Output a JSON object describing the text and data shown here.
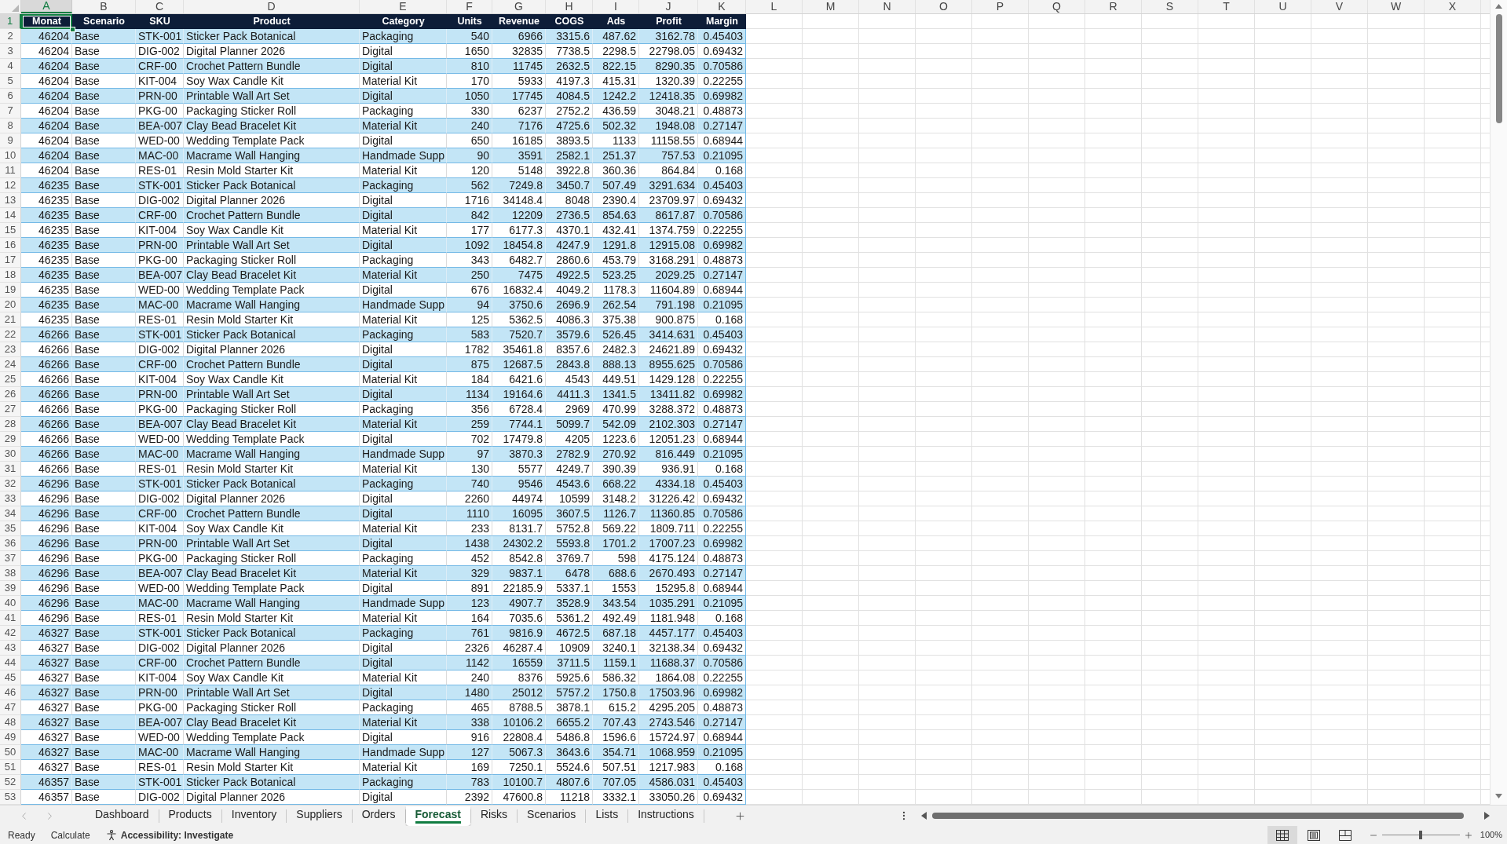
{
  "columns": [
    {
      "letter": "A",
      "selected": true
    },
    {
      "letter": "B",
      "selected": false
    },
    {
      "letter": "C",
      "selected": false
    },
    {
      "letter": "D",
      "selected": false
    },
    {
      "letter": "E",
      "selected": false
    },
    {
      "letter": "F",
      "selected": false
    },
    {
      "letter": "G",
      "selected": false
    },
    {
      "letter": "H",
      "selected": false
    },
    {
      "letter": "I",
      "selected": false
    },
    {
      "letter": "J",
      "selected": false
    },
    {
      "letter": "K",
      "selected": false
    },
    {
      "letter": "L",
      "selected": false
    },
    {
      "letter": "M",
      "selected": false
    },
    {
      "letter": "N",
      "selected": false
    },
    {
      "letter": "O",
      "selected": false
    },
    {
      "letter": "P",
      "selected": false
    },
    {
      "letter": "Q",
      "selected": false
    },
    {
      "letter": "R",
      "selected": false
    },
    {
      "letter": "S",
      "selected": false
    },
    {
      "letter": "T",
      "selected": false
    },
    {
      "letter": "U",
      "selected": false
    },
    {
      "letter": "V",
      "selected": false
    },
    {
      "letter": "W",
      "selected": false
    },
    {
      "letter": "X",
      "selected": false
    }
  ],
  "header_row": {
    "number": "1",
    "selected": true,
    "cells": [
      {
        "label": "Monat",
        "kind": "number"
      },
      {
        "label": "Scenario",
        "kind": "text"
      },
      {
        "label": "SKU",
        "kind": "text"
      },
      {
        "label": "Product",
        "kind": "text"
      },
      {
        "label": "Category",
        "kind": "text"
      },
      {
        "label": "Units",
        "kind": "number"
      },
      {
        "label": "Revenue",
        "kind": "number"
      },
      {
        "label": "COGS",
        "kind": "number"
      },
      {
        "label": "Ads",
        "kind": "number"
      },
      {
        "label": "Profit",
        "kind": "number"
      },
      {
        "label": "Margin",
        "kind": "number"
      }
    ]
  },
  "rows": [
    {
      "number": "2",
      "selected": false,
      "cells": [
        "46204",
        "Base",
        "STK-001",
        "Sticker Pack Botanical",
        "Packaging",
        "540",
        "6966",
        "3315.6",
        "487.62",
        "3162.78",
        "0.45403"
      ]
    },
    {
      "number": "3",
      "selected": false,
      "cells": [
        "46204",
        "Base",
        "DIG-002",
        "Digital Planner 2026",
        "Digital",
        "1650",
        "32835",
        "7738.5",
        "2298.5",
        "22798.05",
        "0.69432"
      ]
    },
    {
      "number": "4",
      "selected": false,
      "cells": [
        "46204",
        "Base",
        "CRF-00",
        "Crochet Pattern Bundle",
        "Digital",
        "810",
        "11745",
        "2632.5",
        "822.15",
        "8290.35",
        "0.70586"
      ]
    },
    {
      "number": "5",
      "selected": false,
      "cells": [
        "46204",
        "Base",
        "KIT-004",
        "Soy Wax Candle Kit",
        "Material Kit",
        "170",
        "5933",
        "4197.3",
        "415.31",
        "1320.39",
        "0.22255"
      ]
    },
    {
      "number": "6",
      "selected": false,
      "cells": [
        "46204",
        "Base",
        "PRN-00",
        "Printable Wall Art Set",
        "Digital",
        "1050",
        "17745",
        "4084.5",
        "1242.2",
        "12418.35",
        "0.69982"
      ]
    },
    {
      "number": "7",
      "selected": false,
      "cells": [
        "46204",
        "Base",
        "PKG-00",
        "Packaging Sticker Roll",
        "Packaging",
        "330",
        "6237",
        "2752.2",
        "436.59",
        "3048.21",
        "0.48873"
      ]
    },
    {
      "number": "8",
      "selected": false,
      "cells": [
        "46204",
        "Base",
        "BEA-007",
        "Clay Bead Bracelet Kit",
        "Material Kit",
        "240",
        "7176",
        "4725.6",
        "502.32",
        "1948.08",
        "0.27147"
      ]
    },
    {
      "number": "9",
      "selected": false,
      "cells": [
        "46204",
        "Base",
        "WED-00",
        "Wedding Template Pack",
        "Digital",
        "650",
        "16185",
        "3893.5",
        "1133",
        "11158.55",
        "0.68944"
      ]
    },
    {
      "number": "10",
      "selected": false,
      "cells": [
        "46204",
        "Base",
        "MAC-00",
        "Macrame Wall Hanging",
        "Handmade Supp",
        "90",
        "3591",
        "2582.1",
        "251.37",
        "757.53",
        "0.21095"
      ]
    },
    {
      "number": "11",
      "selected": false,
      "cells": [
        "46204",
        "Base",
        "RES-01",
        "Resin Mold Starter Kit",
        "Material Kit",
        "120",
        "5148",
        "3922.8",
        "360.36",
        "864.84",
        "0.168"
      ]
    },
    {
      "number": "12",
      "selected": false,
      "cells": [
        "46235",
        "Base",
        "STK-001",
        "Sticker Pack Botanical",
        "Packaging",
        "562",
        "7249.8",
        "3450.7",
        "507.49",
        "3291.634",
        "0.45403"
      ]
    },
    {
      "number": "13",
      "selected": false,
      "cells": [
        "46235",
        "Base",
        "DIG-002",
        "Digital Planner 2026",
        "Digital",
        "1716",
        "34148.4",
        "8048",
        "2390.4",
        "23709.97",
        "0.69432"
      ]
    },
    {
      "number": "14",
      "selected": false,
      "cells": [
        "46235",
        "Base",
        "CRF-00",
        "Crochet Pattern Bundle",
        "Digital",
        "842",
        "12209",
        "2736.5",
        "854.63",
        "8617.87",
        "0.70586"
      ]
    },
    {
      "number": "15",
      "selected": false,
      "cells": [
        "46235",
        "Base",
        "KIT-004",
        "Soy Wax Candle Kit",
        "Material Kit",
        "177",
        "6177.3",
        "4370.1",
        "432.41",
        "1374.759",
        "0.22255"
      ]
    },
    {
      "number": "16",
      "selected": false,
      "cells": [
        "46235",
        "Base",
        "PRN-00",
        "Printable Wall Art Set",
        "Digital",
        "1092",
        "18454.8",
        "4247.9",
        "1291.8",
        "12915.08",
        "0.69982"
      ]
    },
    {
      "number": "17",
      "selected": false,
      "cells": [
        "46235",
        "Base",
        "PKG-00",
        "Packaging Sticker Roll",
        "Packaging",
        "343",
        "6482.7",
        "2860.6",
        "453.79",
        "3168.291",
        "0.48873"
      ]
    },
    {
      "number": "18",
      "selected": false,
      "cells": [
        "46235",
        "Base",
        "BEA-007",
        "Clay Bead Bracelet Kit",
        "Material Kit",
        "250",
        "7475",
        "4922.5",
        "523.25",
        "2029.25",
        "0.27147"
      ]
    },
    {
      "number": "19",
      "selected": false,
      "cells": [
        "46235",
        "Base",
        "WED-00",
        "Wedding Template Pack",
        "Digital",
        "676",
        "16832.4",
        "4049.2",
        "1178.3",
        "11604.89",
        "0.68944"
      ]
    },
    {
      "number": "20",
      "selected": false,
      "cells": [
        "46235",
        "Base",
        "MAC-00",
        "Macrame Wall Hanging",
        "Handmade Supp",
        "94",
        "3750.6",
        "2696.9",
        "262.54",
        "791.198",
        "0.21095"
      ]
    },
    {
      "number": "21",
      "selected": false,
      "cells": [
        "46235",
        "Base",
        "RES-01",
        "Resin Mold Starter Kit",
        "Material Kit",
        "125",
        "5362.5",
        "4086.3",
        "375.38",
        "900.875",
        "0.168"
      ]
    },
    {
      "number": "22",
      "selected": false,
      "cells": [
        "46266",
        "Base",
        "STK-001",
        "Sticker Pack Botanical",
        "Packaging",
        "583",
        "7520.7",
        "3579.6",
        "526.45",
        "3414.631",
        "0.45403"
      ]
    },
    {
      "number": "23",
      "selected": false,
      "cells": [
        "46266",
        "Base",
        "DIG-002",
        "Digital Planner 2026",
        "Digital",
        "1782",
        "35461.8",
        "8357.6",
        "2482.3",
        "24621.89",
        "0.69432"
      ]
    },
    {
      "number": "24",
      "selected": false,
      "cells": [
        "46266",
        "Base",
        "CRF-00",
        "Crochet Pattern Bundle",
        "Digital",
        "875",
        "12687.5",
        "2843.8",
        "888.13",
        "8955.625",
        "0.70586"
      ]
    },
    {
      "number": "25",
      "selected": false,
      "cells": [
        "46266",
        "Base",
        "KIT-004",
        "Soy Wax Candle Kit",
        "Material Kit",
        "184",
        "6421.6",
        "4543",
        "449.51",
        "1429.128",
        "0.22255"
      ]
    },
    {
      "number": "26",
      "selected": false,
      "cells": [
        "46266",
        "Base",
        "PRN-00",
        "Printable Wall Art Set",
        "Digital",
        "1134",
        "19164.6",
        "4411.3",
        "1341.5",
        "13411.82",
        "0.69982"
      ]
    },
    {
      "number": "27",
      "selected": false,
      "cells": [
        "46266",
        "Base",
        "PKG-00",
        "Packaging Sticker Roll",
        "Packaging",
        "356",
        "6728.4",
        "2969",
        "470.99",
        "3288.372",
        "0.48873"
      ]
    },
    {
      "number": "28",
      "selected": false,
      "cells": [
        "46266",
        "Base",
        "BEA-007",
        "Clay Bead Bracelet Kit",
        "Material Kit",
        "259",
        "7744.1",
        "5099.7",
        "542.09",
        "2102.303",
        "0.27147"
      ]
    },
    {
      "number": "29",
      "selected": false,
      "cells": [
        "46266",
        "Base",
        "WED-00",
        "Wedding Template Pack",
        "Digital",
        "702",
        "17479.8",
        "4205",
        "1223.6",
        "12051.23",
        "0.68944"
      ]
    },
    {
      "number": "30",
      "selected": false,
      "cells": [
        "46266",
        "Base",
        "MAC-00",
        "Macrame Wall Hanging",
        "Handmade Supp",
        "97",
        "3870.3",
        "2782.9",
        "270.92",
        "816.449",
        "0.21095"
      ]
    },
    {
      "number": "31",
      "selected": false,
      "cells": [
        "46266",
        "Base",
        "RES-01",
        "Resin Mold Starter Kit",
        "Material Kit",
        "130",
        "5577",
        "4249.7",
        "390.39",
        "936.91",
        "0.168"
      ]
    },
    {
      "number": "32",
      "selected": false,
      "cells": [
        "46296",
        "Base",
        "STK-001",
        "Sticker Pack Botanical",
        "Packaging",
        "740",
        "9546",
        "4543.6",
        "668.22",
        "4334.18",
        "0.45403"
      ]
    },
    {
      "number": "33",
      "selected": false,
      "cells": [
        "46296",
        "Base",
        "DIG-002",
        "Digital Planner 2026",
        "Digital",
        "2260",
        "44974",
        "10599",
        "3148.2",
        "31226.42",
        "0.69432"
      ]
    },
    {
      "number": "34",
      "selected": false,
      "cells": [
        "46296",
        "Base",
        "CRF-00",
        "Crochet Pattern Bundle",
        "Digital",
        "1110",
        "16095",
        "3607.5",
        "1126.7",
        "11360.85",
        "0.70586"
      ]
    },
    {
      "number": "35",
      "selected": false,
      "cells": [
        "46296",
        "Base",
        "KIT-004",
        "Soy Wax Candle Kit",
        "Material Kit",
        "233",
        "8131.7",
        "5752.8",
        "569.22",
        "1809.711",
        "0.22255"
      ]
    },
    {
      "number": "36",
      "selected": false,
      "cells": [
        "46296",
        "Base",
        "PRN-00",
        "Printable Wall Art Set",
        "Digital",
        "1438",
        "24302.2",
        "5593.8",
        "1701.2",
        "17007.23",
        "0.69982"
      ]
    },
    {
      "number": "37",
      "selected": false,
      "cells": [
        "46296",
        "Base",
        "PKG-00",
        "Packaging Sticker Roll",
        "Packaging",
        "452",
        "8542.8",
        "3769.7",
        "598",
        "4175.124",
        "0.48873"
      ]
    },
    {
      "number": "38",
      "selected": false,
      "cells": [
        "46296",
        "Base",
        "BEA-007",
        "Clay Bead Bracelet Kit",
        "Material Kit",
        "329",
        "9837.1",
        "6478",
        "688.6",
        "2670.493",
        "0.27147"
      ]
    },
    {
      "number": "39",
      "selected": false,
      "cells": [
        "46296",
        "Base",
        "WED-00",
        "Wedding Template Pack",
        "Digital",
        "891",
        "22185.9",
        "5337.1",
        "1553",
        "15295.8",
        "0.68944"
      ]
    },
    {
      "number": "40",
      "selected": false,
      "cells": [
        "46296",
        "Base",
        "MAC-00",
        "Macrame Wall Hanging",
        "Handmade Supp",
        "123",
        "4907.7",
        "3528.9",
        "343.54",
        "1035.291",
        "0.21095"
      ]
    },
    {
      "number": "41",
      "selected": false,
      "cells": [
        "46296",
        "Base",
        "RES-01",
        "Resin Mold Starter Kit",
        "Material Kit",
        "164",
        "7035.6",
        "5361.2",
        "492.49",
        "1181.948",
        "0.168"
      ]
    },
    {
      "number": "42",
      "selected": false,
      "cells": [
        "46327",
        "Base",
        "STK-001",
        "Sticker Pack Botanical",
        "Packaging",
        "761",
        "9816.9",
        "4672.5",
        "687.18",
        "4457.177",
        "0.45403"
      ]
    },
    {
      "number": "43",
      "selected": false,
      "cells": [
        "46327",
        "Base",
        "DIG-002",
        "Digital Planner 2026",
        "Digital",
        "2326",
        "46287.4",
        "10909",
        "3240.1",
        "32138.34",
        "0.69432"
      ]
    },
    {
      "number": "44",
      "selected": false,
      "cells": [
        "46327",
        "Base",
        "CRF-00",
        "Crochet Pattern Bundle",
        "Digital",
        "1142",
        "16559",
        "3711.5",
        "1159.1",
        "11688.37",
        "0.70586"
      ]
    },
    {
      "number": "45",
      "selected": false,
      "cells": [
        "46327",
        "Base",
        "KIT-004",
        "Soy Wax Candle Kit",
        "Material Kit",
        "240",
        "8376",
        "5925.6",
        "586.32",
        "1864.08",
        "0.22255"
      ]
    },
    {
      "number": "46",
      "selected": false,
      "cells": [
        "46327",
        "Base",
        "PRN-00",
        "Printable Wall Art Set",
        "Digital",
        "1480",
        "25012",
        "5757.2",
        "1750.8",
        "17503.96",
        "0.69982"
      ]
    },
    {
      "number": "47",
      "selected": false,
      "cells": [
        "46327",
        "Base",
        "PKG-00",
        "Packaging Sticker Roll",
        "Packaging",
        "465",
        "8788.5",
        "3878.1",
        "615.2",
        "4295.205",
        "0.48873"
      ]
    },
    {
      "number": "48",
      "selected": false,
      "cells": [
        "46327",
        "Base",
        "BEA-007",
        "Clay Bead Bracelet Kit",
        "Material Kit",
        "338",
        "10106.2",
        "6655.2",
        "707.43",
        "2743.546",
        "0.27147"
      ]
    },
    {
      "number": "49",
      "selected": false,
      "cells": [
        "46327",
        "Base",
        "WED-00",
        "Wedding Template Pack",
        "Digital",
        "916",
        "22808.4",
        "5486.8",
        "1596.6",
        "15724.97",
        "0.68944"
      ]
    },
    {
      "number": "50",
      "selected": false,
      "cells": [
        "46327",
        "Base",
        "MAC-00",
        "Macrame Wall Hanging",
        "Handmade Supp",
        "127",
        "5067.3",
        "3643.6",
        "354.71",
        "1068.959",
        "0.21095"
      ]
    },
    {
      "number": "51",
      "selected": false,
      "cells": [
        "46327",
        "Base",
        "RES-01",
        "Resin Mold Starter Kit",
        "Material Kit",
        "169",
        "7250.1",
        "5524.6",
        "507.51",
        "1217.983",
        "0.168"
      ]
    },
    {
      "number": "52",
      "selected": false,
      "cells": [
        "46357",
        "Base",
        "STK-001",
        "Sticker Pack Botanical",
        "Packaging",
        "783",
        "10100.7",
        "4807.6",
        "707.05",
        "4586.031",
        "0.45403"
      ]
    },
    {
      "number": "53",
      "selected": false,
      "cells": [
        "46357",
        "Base",
        "DIG-002",
        "Digital Planner 2026",
        "Digital",
        "2392",
        "47600.8",
        "11218",
        "3332.1",
        "33050.26",
        "0.69432"
      ]
    }
  ],
  "sheet_tabs": [
    {
      "label": "Dashboard",
      "selected": false
    },
    {
      "label": "Products",
      "selected": false
    },
    {
      "label": "Inventory",
      "selected": false
    },
    {
      "label": "Suppliers",
      "selected": false
    },
    {
      "label": "Orders",
      "selected": false
    },
    {
      "label": "Forecast",
      "selected": true
    },
    {
      "label": "Risks",
      "selected": false
    },
    {
      "label": "Scenarios",
      "selected": false
    },
    {
      "label": "Lists",
      "selected": false
    },
    {
      "label": "Instructions",
      "selected": false
    }
  ],
  "status_bar": {
    "mode": "Ready",
    "calculate": "Calculate",
    "accessibility": "Accessibility: Investigate",
    "views": [
      {
        "kind": "normal",
        "selected": true
      },
      {
        "kind": "page_layout",
        "selected": false
      },
      {
        "kind": "page_break",
        "selected": false
      }
    ],
    "zoom": {
      "level": 0.5,
      "reading": "100%"
    }
  }
}
